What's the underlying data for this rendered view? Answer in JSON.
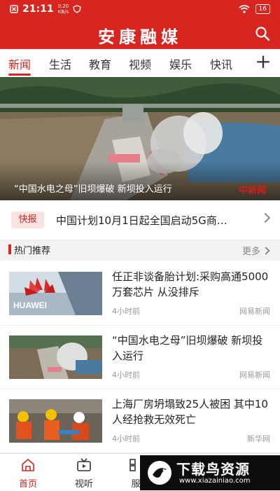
{
  "status_bar": {
    "time": "21:11",
    "speed_value": "0.20",
    "speed_unit": "KB/s",
    "battery": "16"
  },
  "header": {
    "title": "安康融媒"
  },
  "tabs": [
    {
      "label": "新闻",
      "active": true
    },
    {
      "label": "生活"
    },
    {
      "label": "教育"
    },
    {
      "label": "视频"
    },
    {
      "label": "娱乐"
    },
    {
      "label": "快讯"
    }
  ],
  "hero": {
    "caption": "“中国水电之母”旧坝爆破 新坝投入运行",
    "watermark": "中新网"
  },
  "flash": {
    "badge": "快报",
    "text": "中国计划10月1日起全国启动5G商…"
  },
  "section": {
    "title": "热门推荐",
    "more": "更多"
  },
  "news": [
    {
      "title": "任正非谈备胎计划:采购高通5000万套芯片 从没排斥",
      "time": "4小时前",
      "source": "网易新闻"
    },
    {
      "title": "“中国水电之母”旧坝爆破 新坝投入运行",
      "time": "4小时前",
      "source": "网易新闻"
    },
    {
      "title": "上海厂房坍塌致25人被困 其中10人经抢救无效死亡",
      "time": "4小时前",
      "source": "新华网"
    }
  ],
  "bottom_nav": [
    {
      "label": "首页",
      "icon": "home-icon",
      "active": true
    },
    {
      "label": "视听",
      "icon": "tv-icon"
    },
    {
      "label": "服",
      "icon": "grid-icon"
    }
  ],
  "overlay": {
    "brand": "下载鸟资源",
    "url": "www.xiazainiao.com"
  },
  "colors": {
    "brand_red": "#d7251f"
  }
}
